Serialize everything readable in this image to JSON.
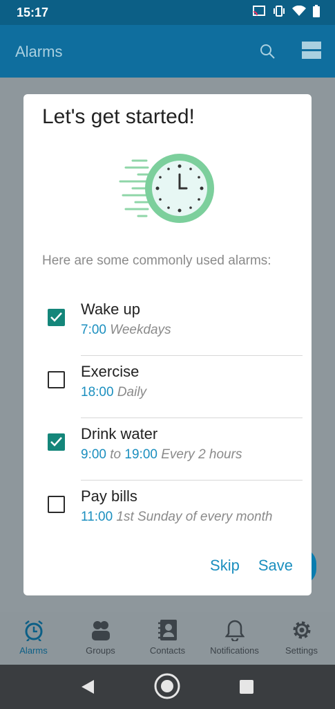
{
  "status": {
    "time": "15:17"
  },
  "appbar": {
    "title": "Alarms"
  },
  "dialog": {
    "title": "Let's get started!",
    "intro": "Here are some commonly used alarms:",
    "items": [
      {
        "name": "Wake up",
        "time1": "7:00",
        "mid": "",
        "time2": "",
        "desc": "Weekdays",
        "checked": true
      },
      {
        "name": "Exercise",
        "time1": "18:00",
        "mid": "",
        "time2": "",
        "desc": "Daily",
        "checked": false
      },
      {
        "name": "Drink water",
        "time1": "9:00",
        "mid": "to",
        "time2": "19:00",
        "desc": "Every 2 hours",
        "checked": true
      },
      {
        "name": "Pay bills",
        "time1": "11:00",
        "mid": "",
        "time2": "",
        "desc": "1st Sunday of every month",
        "checked": false
      }
    ],
    "skip_label": "Skip",
    "save_label": "Save"
  },
  "nav": {
    "items": [
      {
        "label": "Alarms",
        "icon": "alarm-clock-icon",
        "active": true
      },
      {
        "label": "Groups",
        "icon": "groups-icon",
        "active": false
      },
      {
        "label": "Contacts",
        "icon": "contacts-icon",
        "active": false
      },
      {
        "label": "Notifications",
        "icon": "bell-icon",
        "active": false
      },
      {
        "label": "Settings",
        "icon": "gear-icon",
        "active": false
      }
    ]
  },
  "colors": {
    "accent": "#1b8fbf",
    "checkbox": "#14867a",
    "appbar": "#0f6e9e"
  }
}
